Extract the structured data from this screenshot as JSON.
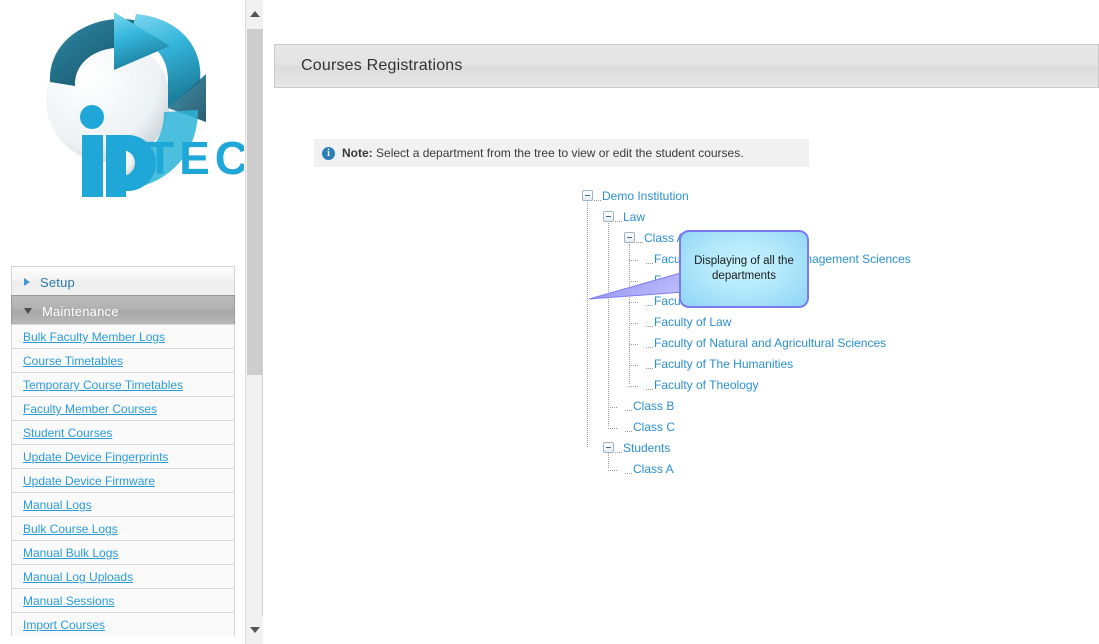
{
  "app": {
    "logo_text": "TECH",
    "logo_mark": "ip"
  },
  "sidebar": {
    "sections": [
      {
        "label": "Setup",
        "state": "collapsed",
        "icon": "chevron-right-icon",
        "items": []
      },
      {
        "label": "Maintenance",
        "state": "expanded",
        "icon": "chevron-down-icon",
        "items": [
          {
            "label": "Bulk Faculty Member Logs"
          },
          {
            "label": "Course Timetables"
          },
          {
            "label": "Temporary Course Timetables"
          },
          {
            "label": "Faculty Member Courses"
          },
          {
            "label": "Student Courses"
          },
          {
            "label": "Update Device Fingerprints"
          },
          {
            "label": "Update Device Firmware"
          },
          {
            "label": "Manual Logs"
          },
          {
            "label": "Bulk Course Logs"
          },
          {
            "label": "Manual Bulk Logs"
          },
          {
            "label": "Manual Log Uploads"
          },
          {
            "label": "Manual Sessions"
          },
          {
            "label": "Import Courses"
          }
        ]
      }
    ],
    "scrollbar": {
      "up_icon": "chevron-up-icon",
      "down_icon": "chevron-down-icon"
    }
  },
  "header": {
    "title": "Courses Registrations"
  },
  "note": {
    "icon": "info-icon",
    "prefix": "Note:",
    "text": "Select a department from the tree to view or edit the student courses."
  },
  "tree": {
    "nodes": [
      {
        "label": "Demo Institution",
        "depth": 0,
        "toggle": "minus-box-icon"
      },
      {
        "label": "Law",
        "depth": 1,
        "toggle": "minus-box-icon"
      },
      {
        "label": "Class A",
        "depth": 2,
        "toggle": "minus-box-icon"
      },
      {
        "label": "Faculty of Economic and Management Sciences",
        "depth": 3,
        "toggle": "leaf"
      },
      {
        "label": "Faculty of Education",
        "depth": 3,
        "toggle": "leaf"
      },
      {
        "label": "Faculty of Health Sciences",
        "depth": 3,
        "toggle": "leaf"
      },
      {
        "label": "Faculty of Law",
        "depth": 3,
        "toggle": "leaf"
      },
      {
        "label": "Faculty of Natural and Agricultural Sciences",
        "depth": 3,
        "toggle": "leaf"
      },
      {
        "label": "Faculty of The Humanities",
        "depth": 3,
        "toggle": "leaf"
      },
      {
        "label": "Faculty of Theology",
        "depth": 3,
        "toggle": "leaf"
      },
      {
        "label": "Class B",
        "depth": 2,
        "toggle": "leaf"
      },
      {
        "label": "Class C",
        "depth": 2,
        "toggle": "leaf"
      },
      {
        "label": "Students",
        "depth": 1,
        "toggle": "minus-box-icon"
      },
      {
        "label": "Class A",
        "depth": 2,
        "toggle": "leaf"
      }
    ]
  },
  "callout": {
    "text": "Displaying of all the departments",
    "fill": "#b3e8fb",
    "border": "#7b7bef"
  },
  "colors": {
    "link": "#2b9bd9",
    "tree_link": "#2b8fd0",
    "accent": "#2b7fb8",
    "section_active_bg": "#b0b0b0"
  }
}
